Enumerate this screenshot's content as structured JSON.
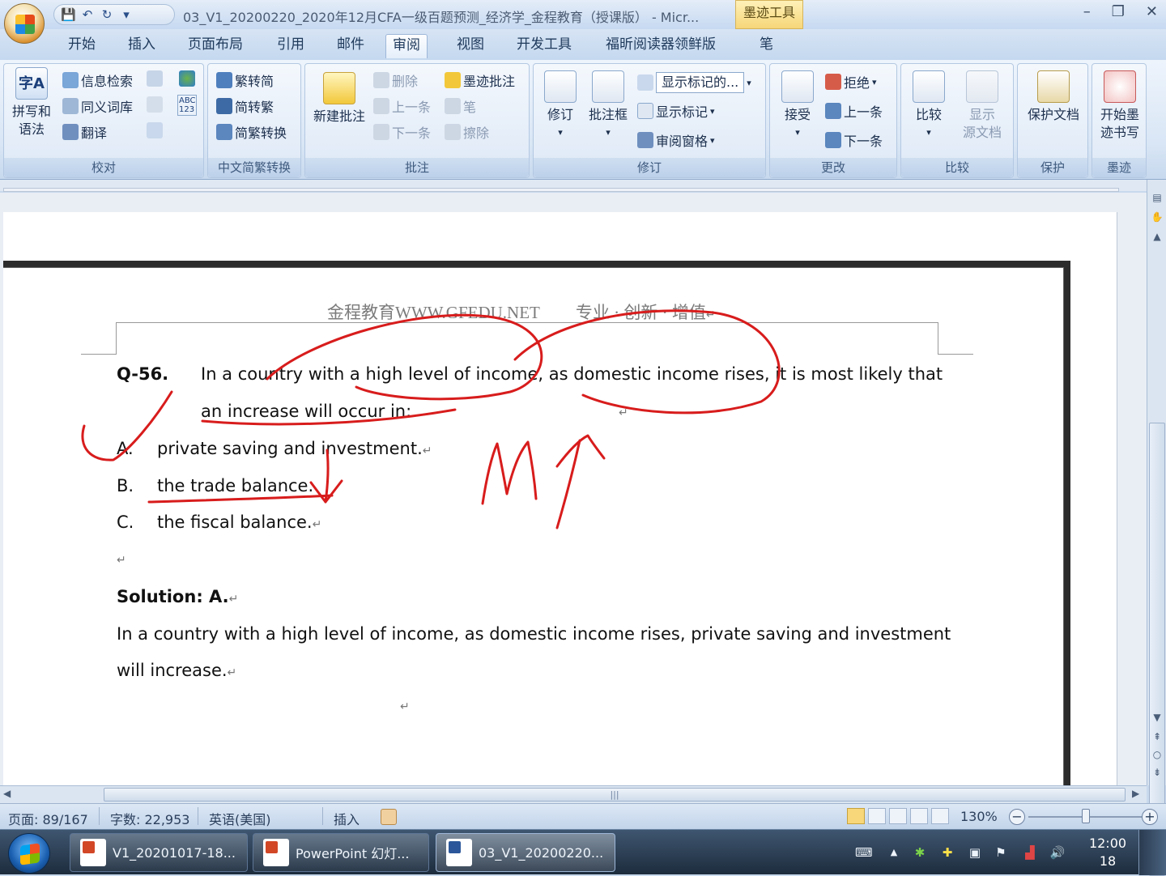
{
  "app": {
    "title": "03_V1_20200220_2020年12月CFA一级百题预测_经济学_金程教育（授课版） - Micr...",
    "contextual_tab": "墨迹工具",
    "help": "?"
  },
  "window_controls": {
    "minimize": "–",
    "restore": "❐",
    "close": "✕"
  },
  "qat": {
    "save": "💾",
    "undo": "↶",
    "redo": "↻",
    "more": "▾"
  },
  "ribbon_tabs": [
    {
      "label": "开始"
    },
    {
      "label": "插入"
    },
    {
      "label": "页面布局"
    },
    {
      "label": "引用"
    },
    {
      "label": "邮件"
    },
    {
      "label": "审阅"
    },
    {
      "label": "视图"
    },
    {
      "label": "开发工具"
    },
    {
      "label": "福昕阅读器领鲜版"
    },
    {
      "label": "笔"
    }
  ],
  "ribbon": {
    "proofing": {
      "label": "校对",
      "spell": "拼写和语法",
      "spell_line1": "拼写和",
      "spell_line2": "语法",
      "research": "信息检索",
      "thesaurus": "同义词库",
      "translate": "翻译",
      "abc": "ABC 123"
    },
    "chinese": {
      "label": "中文简繁转换",
      "to_simplified": "繁转简",
      "to_traditional": "简转繁",
      "convert": "简繁转换"
    },
    "comments": {
      "label": "批注",
      "new": "新建批注",
      "delete": "删除",
      "prev": "上一条",
      "next": "下一条",
      "ink_comment": "墨迹批注",
      "pen": "笔",
      "erase": "擦除"
    },
    "tracking": {
      "label": "修订",
      "track": "修订",
      "balloons": "批注框",
      "display": "显示标记的...",
      "show_markup": "显示标记",
      "pane": "审阅窗格"
    },
    "changes": {
      "label": "更改",
      "accept": "接受",
      "reject": "拒绝",
      "prev": "上一条",
      "next": "下一条"
    },
    "compare": {
      "label": "比较",
      "compare": "比较",
      "show_source": "显示源文档",
      "show_line1": "显示",
      "show_line2": "源文档"
    },
    "protect": {
      "label": "保护",
      "protect_doc": "保护文档"
    },
    "ink": {
      "label": "墨迹",
      "start_inking": "开始墨迹书写",
      "start_line1": "开始墨",
      "start_line2": "迹书写"
    }
  },
  "document": {
    "header_left": "金程教育WWW.GFEDU.NET",
    "header_right": "专业 · 创新 · 增值",
    "question_num": "Q-56.",
    "question_line1": "In a country with a high level of income, as domestic income rises, it is most likely that",
    "question_line2": "an increase will occur in:",
    "options": [
      {
        "letter": "A.",
        "text": "private saving and investment."
      },
      {
        "letter": "B.",
        "text": "the trade balance."
      },
      {
        "letter": "C.",
        "text": "the fiscal balance."
      }
    ],
    "solution_label": "Solution: A.",
    "explanation_line1": "In a country with a high level of income, as domestic income rises, private saving and investment",
    "explanation_line2": "will increase.",
    "paragraph_mark": "↵",
    "ink_note": "MT",
    "ink_color": "#d81c1c"
  },
  "status": {
    "page": "页面: 89/167",
    "words": "字数: 22,953",
    "language": "英语(美国)",
    "mode": "插入",
    "zoom": "130%",
    "zoom_minus": "−",
    "zoom_plus": "+"
  },
  "taskbar": {
    "items": [
      {
        "label": "V1_20201017-18..."
      },
      {
        "label": "PowerPoint 幻灯..."
      },
      {
        "label": "03_V1_20200220..."
      }
    ],
    "time": "12:00",
    "date": "18"
  },
  "colors": {
    "accent": "#2f6fc5",
    "ink": "#d81c1c",
    "ribbon_bg": "#dde8f6"
  }
}
